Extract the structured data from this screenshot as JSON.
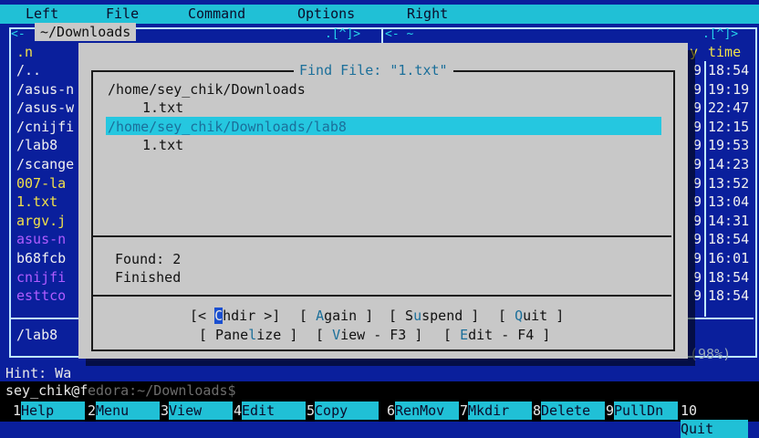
{
  "menu": [
    "Left",
    "File",
    "Command",
    "Options",
    "Right"
  ],
  "left_panel": {
    "path_tab": "~/Downloads",
    "top_right_marks": ".[^]>",
    "column_header": ".n",
    "rows": [
      {
        "name": "/..",
        "color": "white"
      },
      {
        "name": "/asus-n",
        "color": "white"
      },
      {
        "name": "/asus-w",
        "color": "white"
      },
      {
        "name": "/cnijfi",
        "color": "white"
      },
      {
        "name": "/lab8",
        "color": "white"
      },
      {
        "name": "/scange",
        "color": "white"
      },
      {
        "name": "007-la",
        "color": "yellow"
      },
      {
        "name": "1.txt",
        "color": "yellow"
      },
      {
        "name": "argv.j",
        "color": "yellow"
      },
      {
        "name": "asus-n",
        "color": "magenta"
      },
      {
        "name": "b68fcb",
        "color": "white"
      },
      {
        "name": "cnijfi",
        "color": "magenta"
      },
      {
        "name": "esttco",
        "color": "magenta"
      }
    ],
    "status": "/lab8"
  },
  "right_panel": {
    "top_marks_left": "<- ~",
    "top_marks_right": ".[^]>",
    "header_y": "y",
    "header_time": "time",
    "times": [
      "18:54",
      "19:19",
      "22:47",
      "12:15",
      "19:53",
      "14:23",
      "13:52",
      "13:04",
      "14:31",
      "18:54",
      "16:01",
      "18:54",
      "18:54"
    ],
    "prefix_digits": [
      "9",
      "9",
      "9",
      "9",
      "9",
      "9",
      "9",
      "9",
      "9",
      "9",
      "9",
      "9",
      "9"
    ],
    "usage": "(98%)"
  },
  "dialog": {
    "title": "Find File: \"1.txt\"",
    "results": [
      {
        "text": "/home/sey_chik/Downloads",
        "indent": false
      },
      {
        "text": "1.txt",
        "indent": true
      },
      {
        "text": "/home/sey_chik/Downloads/lab8",
        "indent": false,
        "selected": true
      },
      {
        "text": "1.txt",
        "indent": true
      }
    ],
    "found": "Found: 2",
    "status": "Finished",
    "buttons_row1": {
      "chdir_pre": "[< ",
      "chdir_hot": "C",
      "chdir_rest": "hdir >]",
      "again_pre": "[ ",
      "again_hot": "A",
      "again_rest": "gain ]",
      "suspend_pre": "[ S",
      "suspend_hot": "u",
      "suspend_rest": "spend ]",
      "quit_pre": "[ ",
      "quit_hot": "Q",
      "quit_rest": "uit ]"
    },
    "buttons_row2": {
      "panelize_pre": "[ Pane",
      "panelize_hot": "l",
      "panelize_rest": "ize ]",
      "view_pre": "[ ",
      "view_hot": "V",
      "view_rest": "iew - F3 ]",
      "edit_pre": "[ ",
      "edit_hot": "E",
      "edit_rest": "dit - F4 ]"
    }
  },
  "hint": "Hint: Wa",
  "cmdline": {
    "prompt": "sey_chik@f",
    "faded": "edora:~/Downloads$"
  },
  "fkeys": [
    {
      "num": "1",
      "label": "Help"
    },
    {
      "num": "2",
      "label": "Menu"
    },
    {
      "num": "3",
      "label": "View"
    },
    {
      "num": "4",
      "label": "Edit"
    },
    {
      "num": "5",
      "label": "Copy"
    },
    {
      "num": "6",
      "label": "RenMov"
    },
    {
      "num": "7",
      "label": "Mkdir"
    },
    {
      "num": "8",
      "label": "Delete"
    },
    {
      "num": "9",
      "label": "PullDn"
    },
    {
      "num": "10",
      "label": "Quit"
    }
  ],
  "colors": {
    "menu_bg": "#20c0d6",
    "panel_bg": "#0a1f9c",
    "dialog_bg": "#c8c8c8",
    "highlight": "#25c7e0"
  }
}
